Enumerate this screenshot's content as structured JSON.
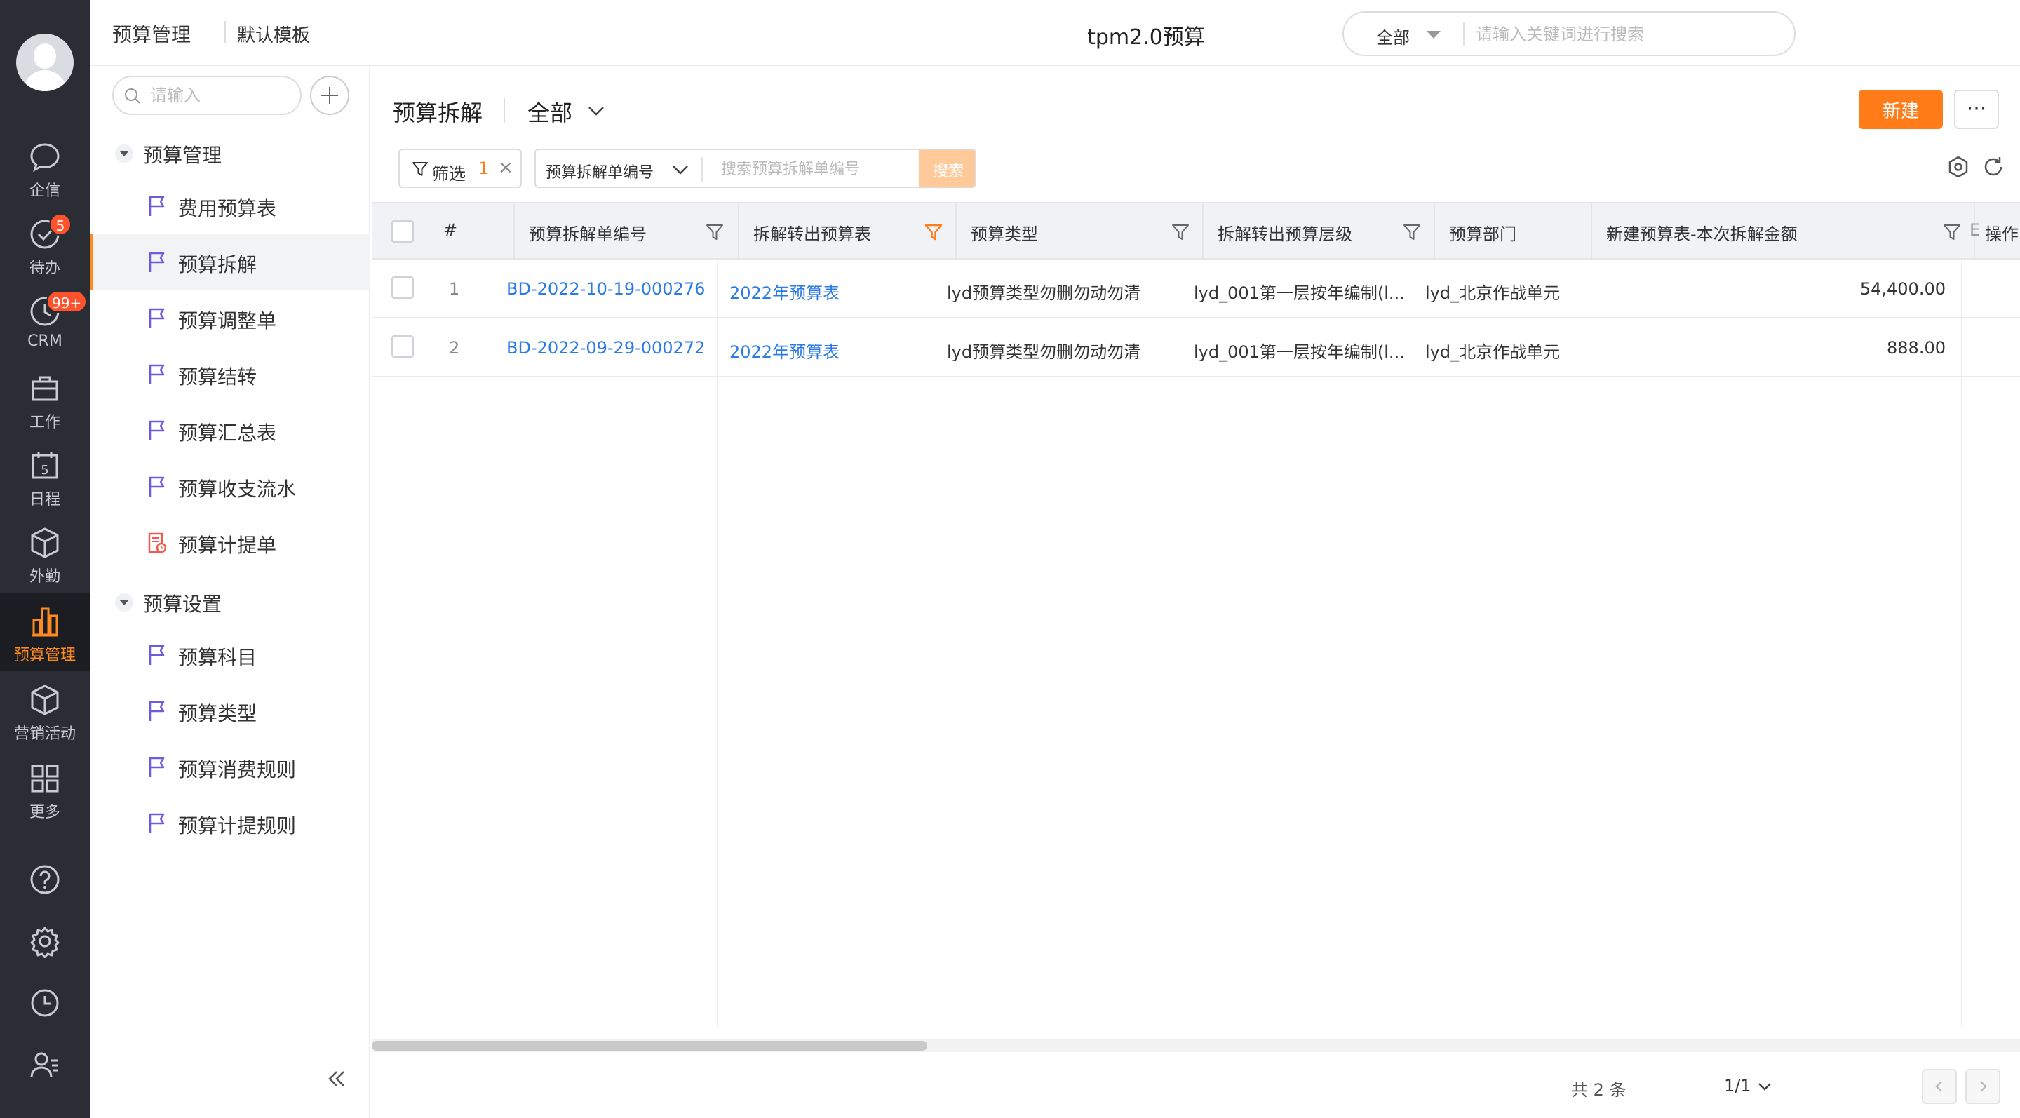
{
  "nav_rail": {
    "items": [
      {
        "label": "企信",
        "icon": "chat-bubble-icon"
      },
      {
        "label": "待办",
        "icon": "check-circle-icon",
        "badge": "5"
      },
      {
        "label": "CRM",
        "icon": "clock-icon",
        "badge": "99+"
      },
      {
        "label": "工作",
        "icon": "briefcase-icon"
      },
      {
        "label": "日程",
        "icon": "calendar-icon",
        "day": "5"
      },
      {
        "label": "外勤",
        "icon": "cube-icon"
      },
      {
        "label": "预算管理",
        "icon": "bar-chart-icon",
        "active": true
      },
      {
        "label": "营销活动",
        "icon": "cube-icon"
      },
      {
        "label": "更多",
        "icon": "grid-icon"
      }
    ],
    "tools": [
      "help-icon",
      "settings-icon",
      "history-icon",
      "contacts-icon"
    ]
  },
  "topbar": {
    "breadcrumb": "预算管理",
    "template": "默认模板",
    "title": "tpm2.0预算",
    "search_scope": "全部",
    "search_placeholder": "请输入关键词进行搜索"
  },
  "sidebar": {
    "search_placeholder": "请输入",
    "groups": [
      {
        "label": "预算管理",
        "items": [
          {
            "label": "费用预算表",
            "icon": "flag-icon"
          },
          {
            "label": "预算拆解",
            "icon": "flag-icon",
            "active": true
          },
          {
            "label": "预算调整单",
            "icon": "flag-icon"
          },
          {
            "label": "预算结转",
            "icon": "flag-icon"
          },
          {
            "label": "预算汇总表",
            "icon": "flag-icon"
          },
          {
            "label": "预算收支流水",
            "icon": "flag-icon"
          },
          {
            "label": "预算计提单",
            "icon": "document-icon"
          }
        ]
      },
      {
        "label": "预算设置",
        "items": [
          {
            "label": "预算科目",
            "icon": "flag-icon"
          },
          {
            "label": "预算类型",
            "icon": "flag-icon"
          },
          {
            "label": "预算消费规则",
            "icon": "flag-icon"
          },
          {
            "label": "预算计提规则",
            "icon": "flag-icon"
          }
        ]
      }
    ]
  },
  "page": {
    "title": "预算拆解",
    "scope": "全部",
    "new_label": "新建",
    "more_label": "···",
    "filter_label": "筛选",
    "filter_count": "1",
    "field_select": "预算拆解单编号",
    "field_placeholder": "搜索预算拆解单编号",
    "search_label": "搜索"
  },
  "table": {
    "columns": [
      {
        "key": "index",
        "label": "#"
      },
      {
        "key": "code",
        "label": "预算拆解单编号",
        "filter": true
      },
      {
        "key": "source",
        "label": "拆解转出预算表",
        "filter": true,
        "filter_active": true
      },
      {
        "key": "type",
        "label": "预算类型",
        "filter": true
      },
      {
        "key": "level",
        "label": "拆解转出预算层级",
        "filter": true
      },
      {
        "key": "dept",
        "label": "预算部门"
      },
      {
        "key": "amount",
        "label": "新建预算表-本次拆解金额",
        "filter": true
      },
      {
        "key": "extra",
        "label": "E"
      },
      {
        "key": "ops",
        "label": "操作"
      }
    ],
    "rows": [
      {
        "index": "1",
        "code": "BD-2022-10-19-000276",
        "source": "2022年预算表",
        "type": "lyd预算类型勿删勿动勿清",
        "level": "lyd_001第一层按年编制(l...",
        "dept": "lyd_北京作战单元",
        "amount": "54,400.00"
      },
      {
        "index": "2",
        "code": "BD-2022-09-29-000272",
        "source": "2022年预算表",
        "type": "lyd预算类型勿删勿动勿清",
        "level": "lyd_001第一层按年编制(l...",
        "dept": "lyd_北京作战单元",
        "amount": "888.00"
      }
    ]
  },
  "pager": {
    "total": "共 2 条",
    "page": "1/1"
  },
  "colors": {
    "accent": "#ff7c19",
    "link": "#2b7be5",
    "rail_bg": "#2a2d34",
    "flag": "#6b5ce0"
  }
}
